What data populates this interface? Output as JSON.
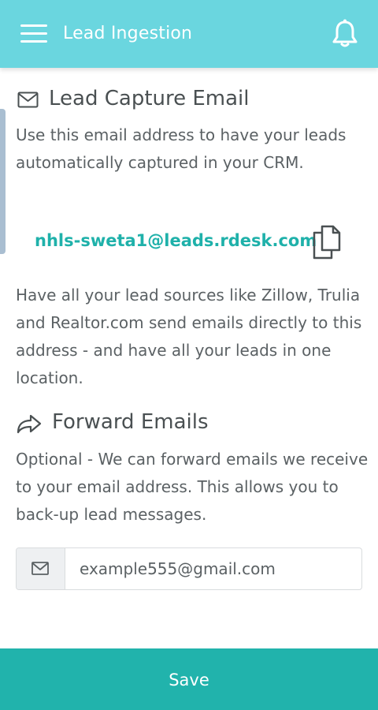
{
  "header": {
    "title": "Lead Ingestion",
    "menu_icon": "hamburger-menu-icon",
    "notification_icon": "bell-icon",
    "background_color": "#6ad6df"
  },
  "lead_capture": {
    "icon": "envelope-icon",
    "title": "Lead Capture Email",
    "description": "Use this email address to have your leads automatically captured in your CRM.",
    "email": "nhls-sweta1@leads.rdesk.com",
    "email_color": "#1fb1aa",
    "copy_icon": "copy-icon",
    "sources_text": "Have all your lead sources like Zillow, Trulia and Realtor.com send emails directly to this address - and have all your leads in one location."
  },
  "forward": {
    "icon": "share-arrow-icon",
    "title": "Forward Emails",
    "description": "Optional - We can forward emails we receive to your email address. This allows you to back-up lead messages.",
    "input_icon": "envelope-icon",
    "input_value": "example555@gmail.com"
  },
  "footer": {
    "save_label": "Save",
    "save_color": "#21b3ac"
  }
}
